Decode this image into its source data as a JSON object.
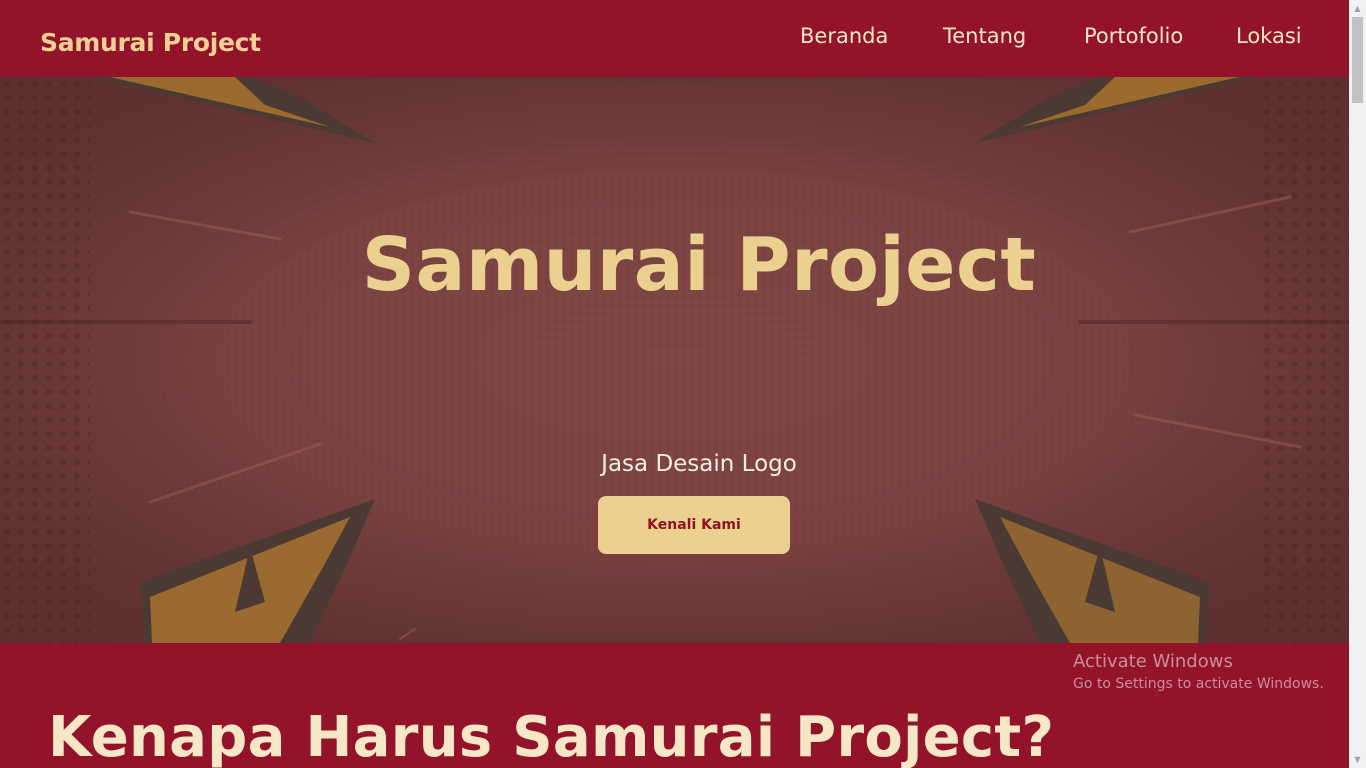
{
  "navbar": {
    "brand": "Samurai Project",
    "links": [
      {
        "label": "Beranda"
      },
      {
        "label": "Tentang"
      },
      {
        "label": "Portofolio"
      },
      {
        "label": "Lokasi"
      }
    ]
  },
  "hero": {
    "title": "Samurai Project",
    "subtitle": "Jasa Desain Logo",
    "cta_label": "Kenali Kami"
  },
  "section": {
    "title": "Kenapa Harus Samurai Project?"
  },
  "os_overlay": {
    "title": "Activate Windows",
    "message": "Go to Settings to activate Windows."
  },
  "colors": {
    "primary": "#93142a",
    "accent": "#ecd08f",
    "hero_bg": "#7a4241"
  },
  "icons": {
    "scroll_up": "scroll-up-arrow-icon",
    "scroll_down": "scroll-down-arrow-icon"
  }
}
